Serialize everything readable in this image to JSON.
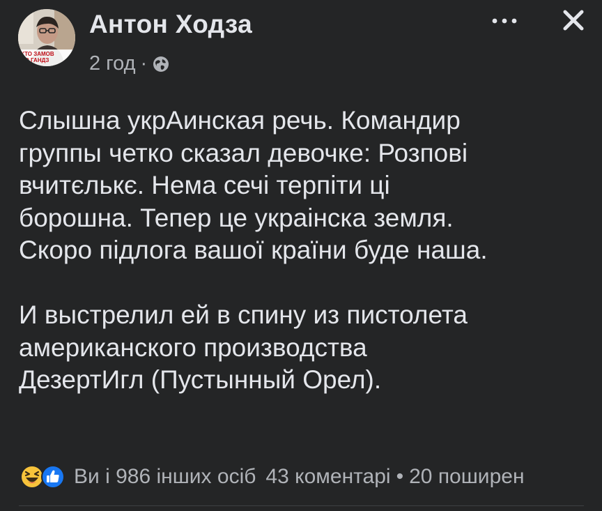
{
  "post": {
    "author": "Антон Ходза",
    "time": "2 год",
    "meta_separator": "·",
    "privacy_icon": "globe-icon",
    "avatar_caption_lines": [
      "КТО ЗАМОВ",
      "ВО ГАНДЗ"
    ],
    "body_lines": [
      "Слышна укрАинская речь. Командир",
      "группы четко сказал девочке: Розпові",
      "вчитєлькє. Нема сечі терпіти ці",
      "борошна. Тепер це украінска земля.",
      "Скоро підлога вашої країни буде наша."
    ],
    "body_lines_2": [
      "И выстрелил ей в спину из пистолета",
      "американского производства",
      "ДезертИгл (Пустынный Орел)."
    ]
  },
  "header_actions": {
    "more_icon": "more-horizontal-icon",
    "close_icon": "close-icon"
  },
  "reactions": {
    "icons": [
      "haha-reaction-icon",
      "like-reaction-icon"
    ],
    "summary": "Ви і 986 інших осіб",
    "comments": "43 коментарі",
    "separator": "•",
    "shares": "20 поширен"
  },
  "colors": {
    "background": "#242526",
    "primary_text": "#e4e6eb",
    "secondary_text": "#b0b3b8",
    "like_blue": "#1877f2",
    "haha_yellow": "#f7c33b"
  }
}
